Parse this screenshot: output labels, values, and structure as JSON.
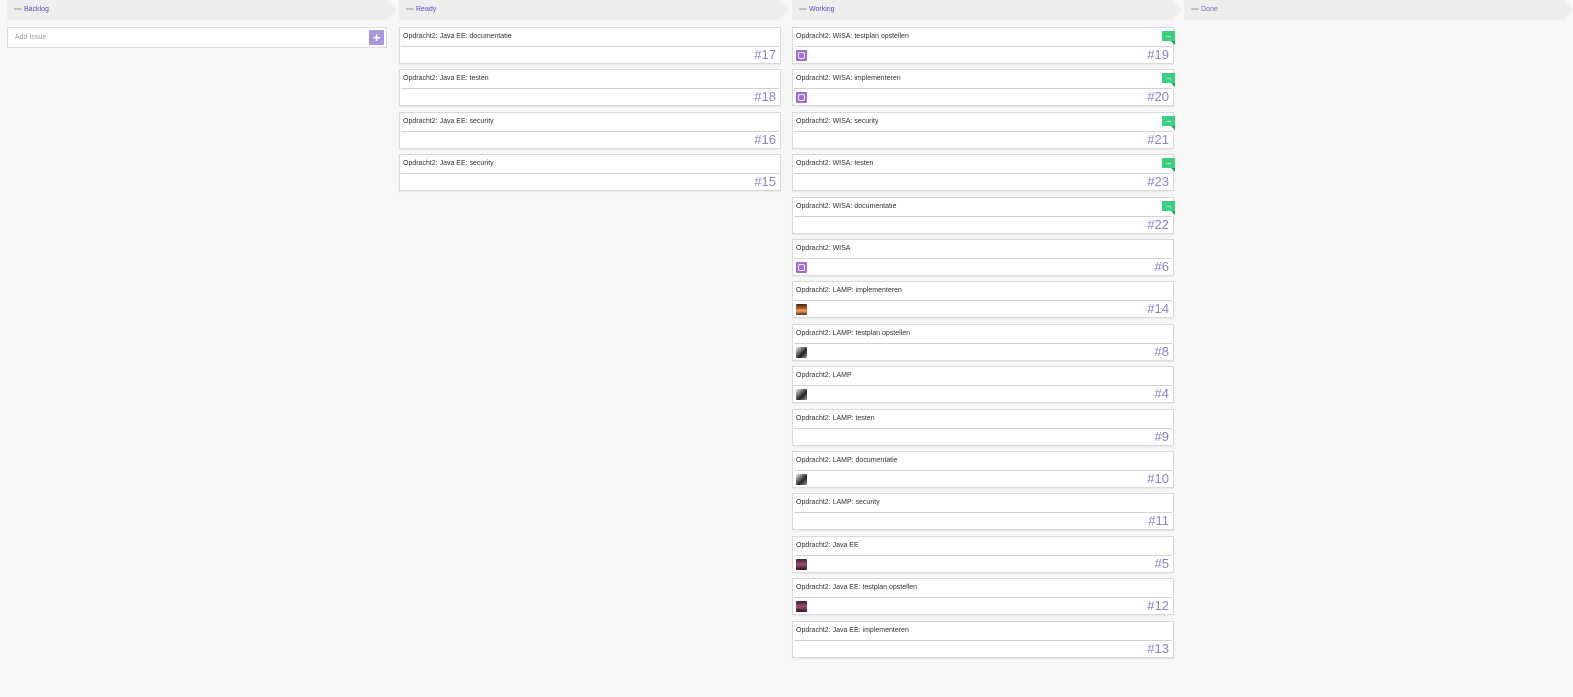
{
  "columns": {
    "backlog": {
      "title": "Backlog",
      "add_placeholder": "Add Issue",
      "add_button_label": "+"
    },
    "ready": {
      "title": "Ready",
      "cards": [
        {
          "title": "Opdracht2: Java EE: documentatie",
          "number": "#17"
        },
        {
          "title": "Opdracht2: Java EE: testen",
          "number": "#18"
        },
        {
          "title": "Opdracht2: Java EE: security",
          "number": "#16"
        },
        {
          "title": "Opdracht2: Java EE: security",
          "number": "#15"
        }
      ]
    },
    "working": {
      "title": "Working",
      "cards": [
        {
          "title": "Opdracht2: WISA: testplan opstellen",
          "number": "#19",
          "avatar": "purple-avatar-icon",
          "flag": "arrow-right-icon"
        },
        {
          "title": "Opdracht2: WISA: implementeren",
          "number": "#20",
          "avatar": "purple-avatar-icon",
          "flag": "arrow-right-icon"
        },
        {
          "title": "Opdracht2: WISA: security",
          "number": "#21",
          "flag": "arrow-right-icon"
        },
        {
          "title": "Opdracht2: WISA: testen",
          "number": "#23",
          "flag": "arrow-right-icon"
        },
        {
          "title": "Opdracht2: WISA: documentatie",
          "number": "#22",
          "flag": "arrow-right-icon"
        },
        {
          "title": "Opdracht2: WISA",
          "number": "#6",
          "avatar": "purple-avatar-icon"
        },
        {
          "title": "Opdracht2: LAMP: implementeren",
          "number": "#14",
          "avatar": "face-photo-avatar"
        },
        {
          "title": "Opdracht2: LAMP: testplan opstellen",
          "number": "#8",
          "avatar": "dark-photo-avatar"
        },
        {
          "title": "Opdracht2: LAMP",
          "number": "#4",
          "avatar": "dark-photo-avatar"
        },
        {
          "title": "Opdracht2: LAMP: testen",
          "number": "#9"
        },
        {
          "title": "Opdracht2: LAMP: documentatie",
          "number": "#10",
          "avatar": "dark-photo-avatar"
        },
        {
          "title": "Opdracht2: LAMP: security",
          "number": "#11"
        },
        {
          "title": "Opdracht2: Java EE",
          "number": "#5",
          "avatar": "pink-photo-avatar"
        },
        {
          "title": "Opdracht2: Java EE: testplan opstellen",
          "number": "#12",
          "avatar": "pink-photo-avatar"
        },
        {
          "title": "Opdracht2: Java EE: implementeren",
          "number": "#13"
        }
      ]
    },
    "done": {
      "title": "Done"
    }
  },
  "colors": {
    "accent": "#5b4fc0",
    "issue_number": "#8a82c9",
    "flag": "#3ccf7f",
    "add_button": "#a898de"
  }
}
